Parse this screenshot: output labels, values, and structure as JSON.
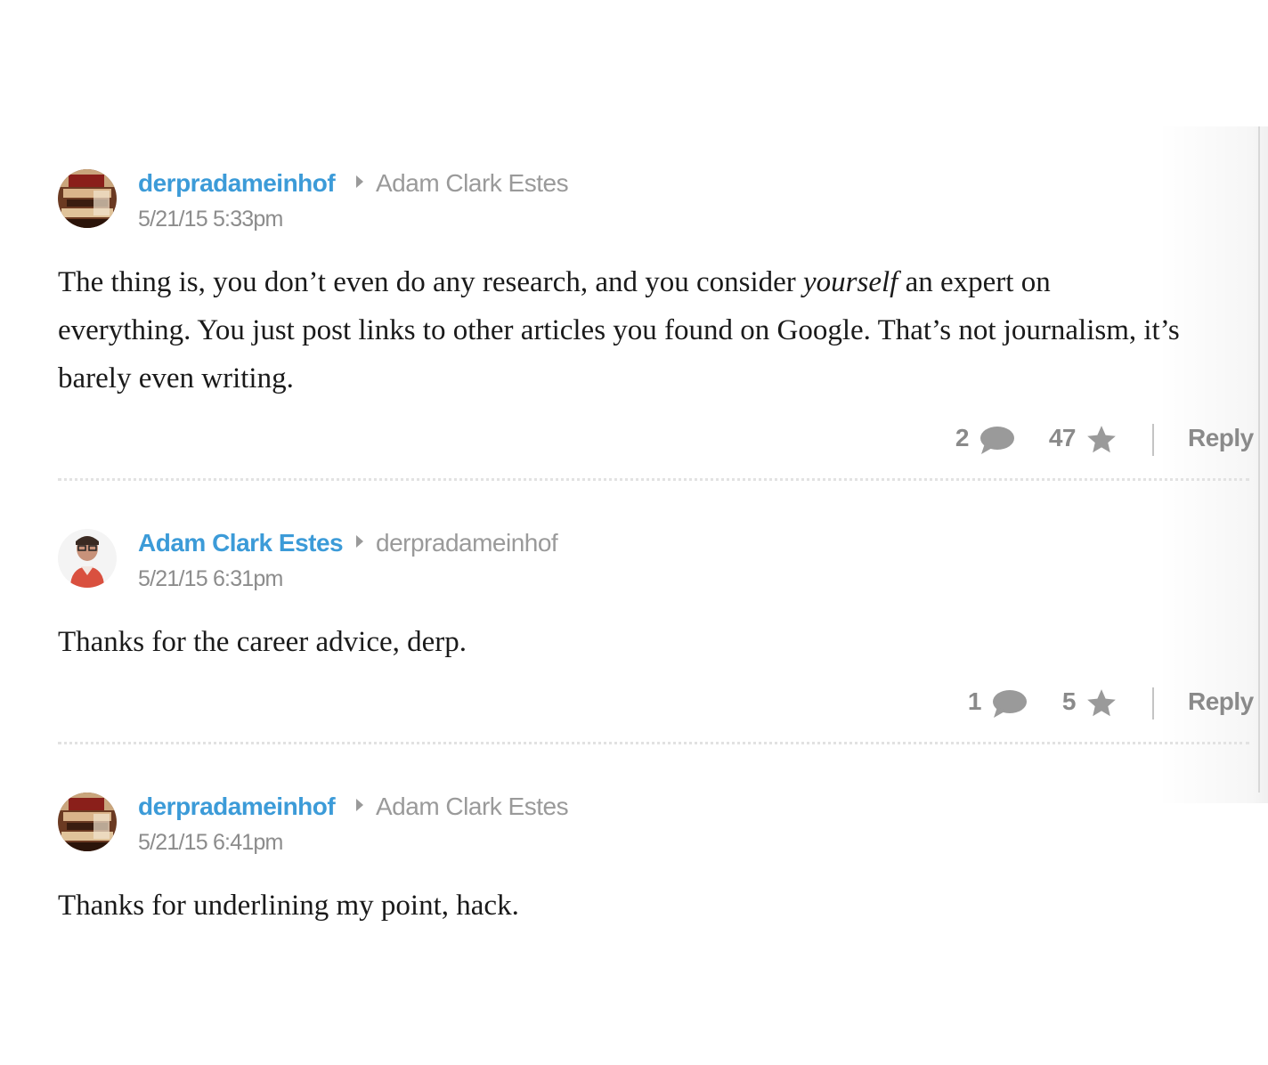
{
  "comments": [
    {
      "author": "derpradameinhof",
      "reply_to": "Adam Clark Estes",
      "timestamp": "5/21/15 5:33pm",
      "body_pre": "The thing is, you don’t even do any research, and you consider ",
      "body_em": "yourself",
      "body_post": " an expert on everything. You just post links to other articles you found on Google. That’s not journalism, it’s barely even writing.",
      "reply_count": "2",
      "star_count": "47",
      "reply_label": "Reply"
    },
    {
      "author": "Adam Clark Estes",
      "reply_to": "derpradameinhof",
      "timestamp": "5/21/15 6:31pm",
      "body": "Thanks for the career advice, derp.",
      "reply_count": "1",
      "star_count": "5",
      "reply_label": "Reply"
    },
    {
      "author": "derpradameinhof",
      "reply_to": "Adam Clark Estes",
      "timestamp": "5/21/15 6:41pm",
      "body": "Thanks for underlining my point, hack."
    }
  ],
  "colors": {
    "author_link": "#3c9bd8",
    "meta_gray": "#8a8a8a",
    "body_text": "#1a1a1a"
  },
  "icons": {
    "reply_indicator": "caret-right-icon",
    "replies": "speech-bubble-icon",
    "stars": "star-icon"
  }
}
